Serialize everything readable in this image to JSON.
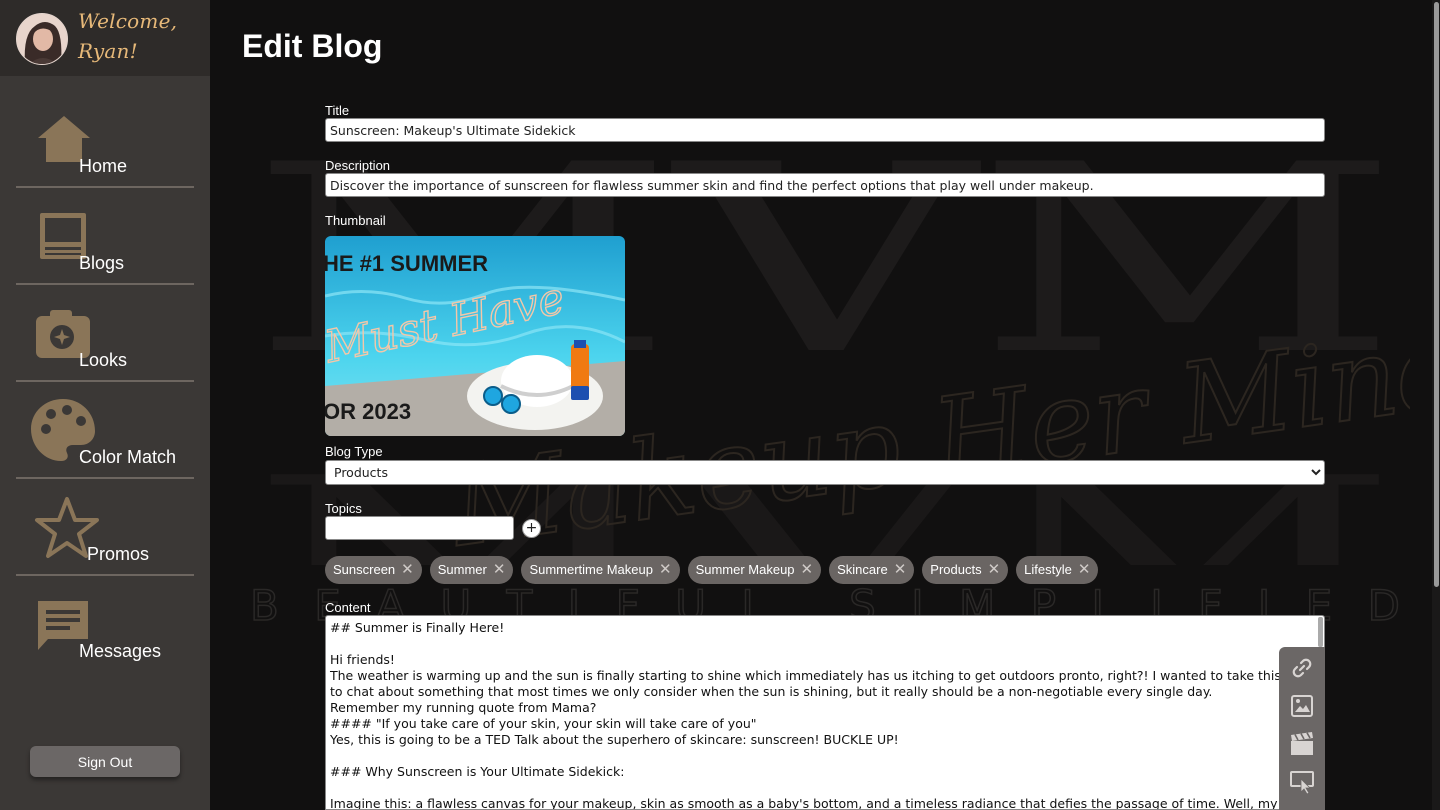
{
  "welcome": {
    "line1": "Welcome,",
    "line2": "Ryan!"
  },
  "nav": [
    {
      "label": "Home",
      "icon": "home-icon"
    },
    {
      "label": "Blogs",
      "icon": "laptop-icon"
    },
    {
      "label": "Looks",
      "icon": "camera-icon"
    },
    {
      "label": "Color Match",
      "icon": "palette-icon"
    },
    {
      "label": "Promos",
      "icon": "star-icon"
    },
    {
      "label": "Messages",
      "icon": "message-icon"
    }
  ],
  "sign_out": "Sign Out",
  "page_title": "Edit Blog",
  "form": {
    "title_label": "Title",
    "title_value": "Sunscreen: Makeup's Ultimate Sidekick",
    "description_label": "Description",
    "description_value": "Discover the importance of sunscreen for flawless summer skin and find the perfect options that play well under makeup.",
    "thumbnail_label": "Thumbnail",
    "thumbnail_text": {
      "line1": "HE #1 SUMMER",
      "line2": "Must Have",
      "line3": "OR 2023"
    },
    "blog_type_label": "Blog Type",
    "blog_type_value": "Products",
    "topics_label": "Topics",
    "topics_input_value": "",
    "add_topic": "+",
    "tags": [
      "Sunscreen",
      "Summer",
      "Summertime Makeup",
      "Summer Makeup",
      "Skincare",
      "Products",
      "Lifestyle"
    ],
    "tag_remove": "✕",
    "content_label": "Content",
    "content_lines": [
      "## Summer is Finally Here!",
      "",
      "Hi friends!",
      "The weather is warming up and the sun is finally starting to shine which immediately has us itching to get outdoors pronto, right?! I wanted to take this",
      "to chat about something that most times we only consider when the sun is shining, but it really should be a non-negotiable every single day.",
      "Remember my running quote from Mama?",
      "#### \"If you take care of your skin, your skin will take care of you\"",
      "Yes, this is going to be a TED Talk about the superhero of skincare: sunscreen! BUCKLE UP!",
      "",
      "### Why Sunscreen is Your Ultimate Sidekick:",
      "",
      "Imagine this: a flawless canvas for your makeup, skin as smooth as a baby's bottom, and a timeless radiance that defies the passage of time. Well, my f"
    ]
  },
  "toolbar": [
    "link-icon",
    "image-icon",
    "video-clapper-icon",
    "embed-icon"
  ],
  "watermark": {
    "tagline": "BEAUTIFUL SIMPLIFIED",
    "script": "Makeup Her Mind"
  },
  "colors": {
    "accent": "#e7b979",
    "sidebar": "#3b3836",
    "icon_tan": "#8a7558",
    "background": "#111010"
  }
}
